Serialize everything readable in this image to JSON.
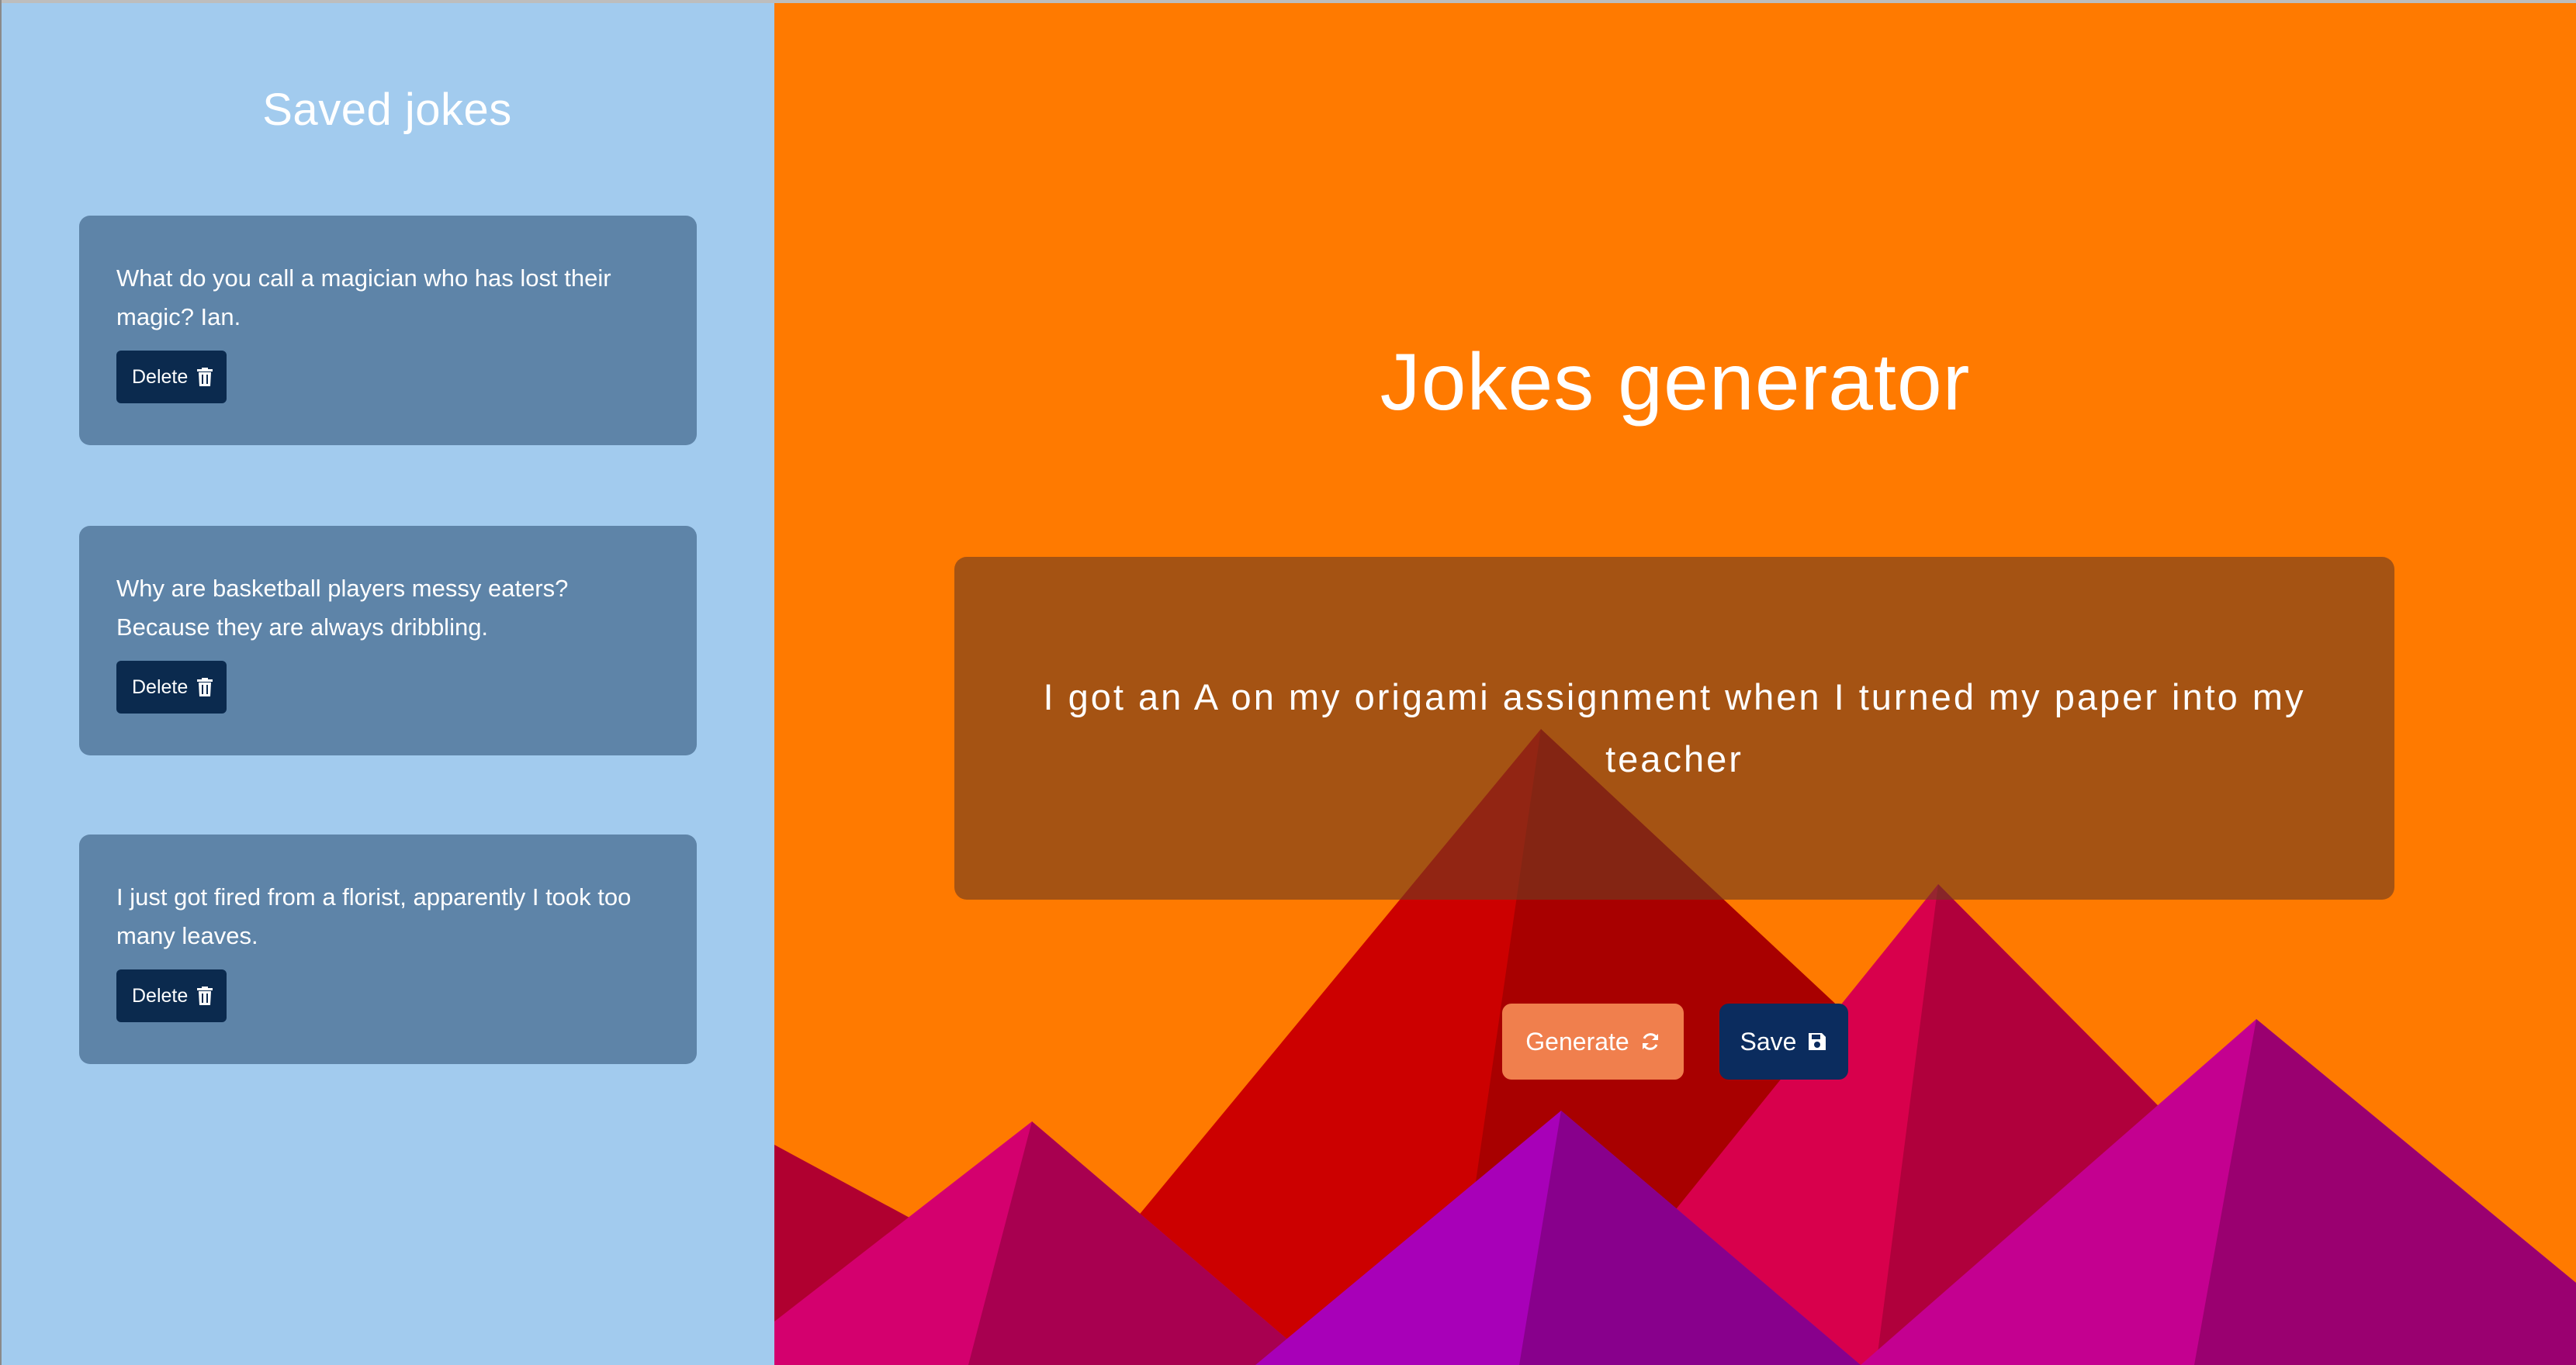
{
  "sidebar": {
    "title": "Saved jokes",
    "jokes": [
      {
        "text": "What do you call a magician who has lost their magic? Ian.",
        "delete_label": "Delete"
      },
      {
        "text": "Why are basketball players messy eaters? Because they are always dribbling.",
        "delete_label": "Delete"
      },
      {
        "text": "I just got fired from a florist, apparently I took too many leaves.",
        "delete_label": "Delete"
      }
    ]
  },
  "main": {
    "title": "Jokes generator",
    "current_joke": "I got an A on my origami assignment when I turned my paper into my teacher",
    "generate_label": "Generate",
    "save_label": "Save"
  },
  "icons": {
    "delete": "trash-icon",
    "generate": "refresh-icon",
    "save": "floppy-disk-icon"
  },
  "colors": {
    "sidebar_bg": "#a2cbee",
    "card_bg": "#5e84a8",
    "main_bg": "#ff7a00",
    "dark_button": "#0b2c5e",
    "generate_button": "#f07f4d"
  }
}
